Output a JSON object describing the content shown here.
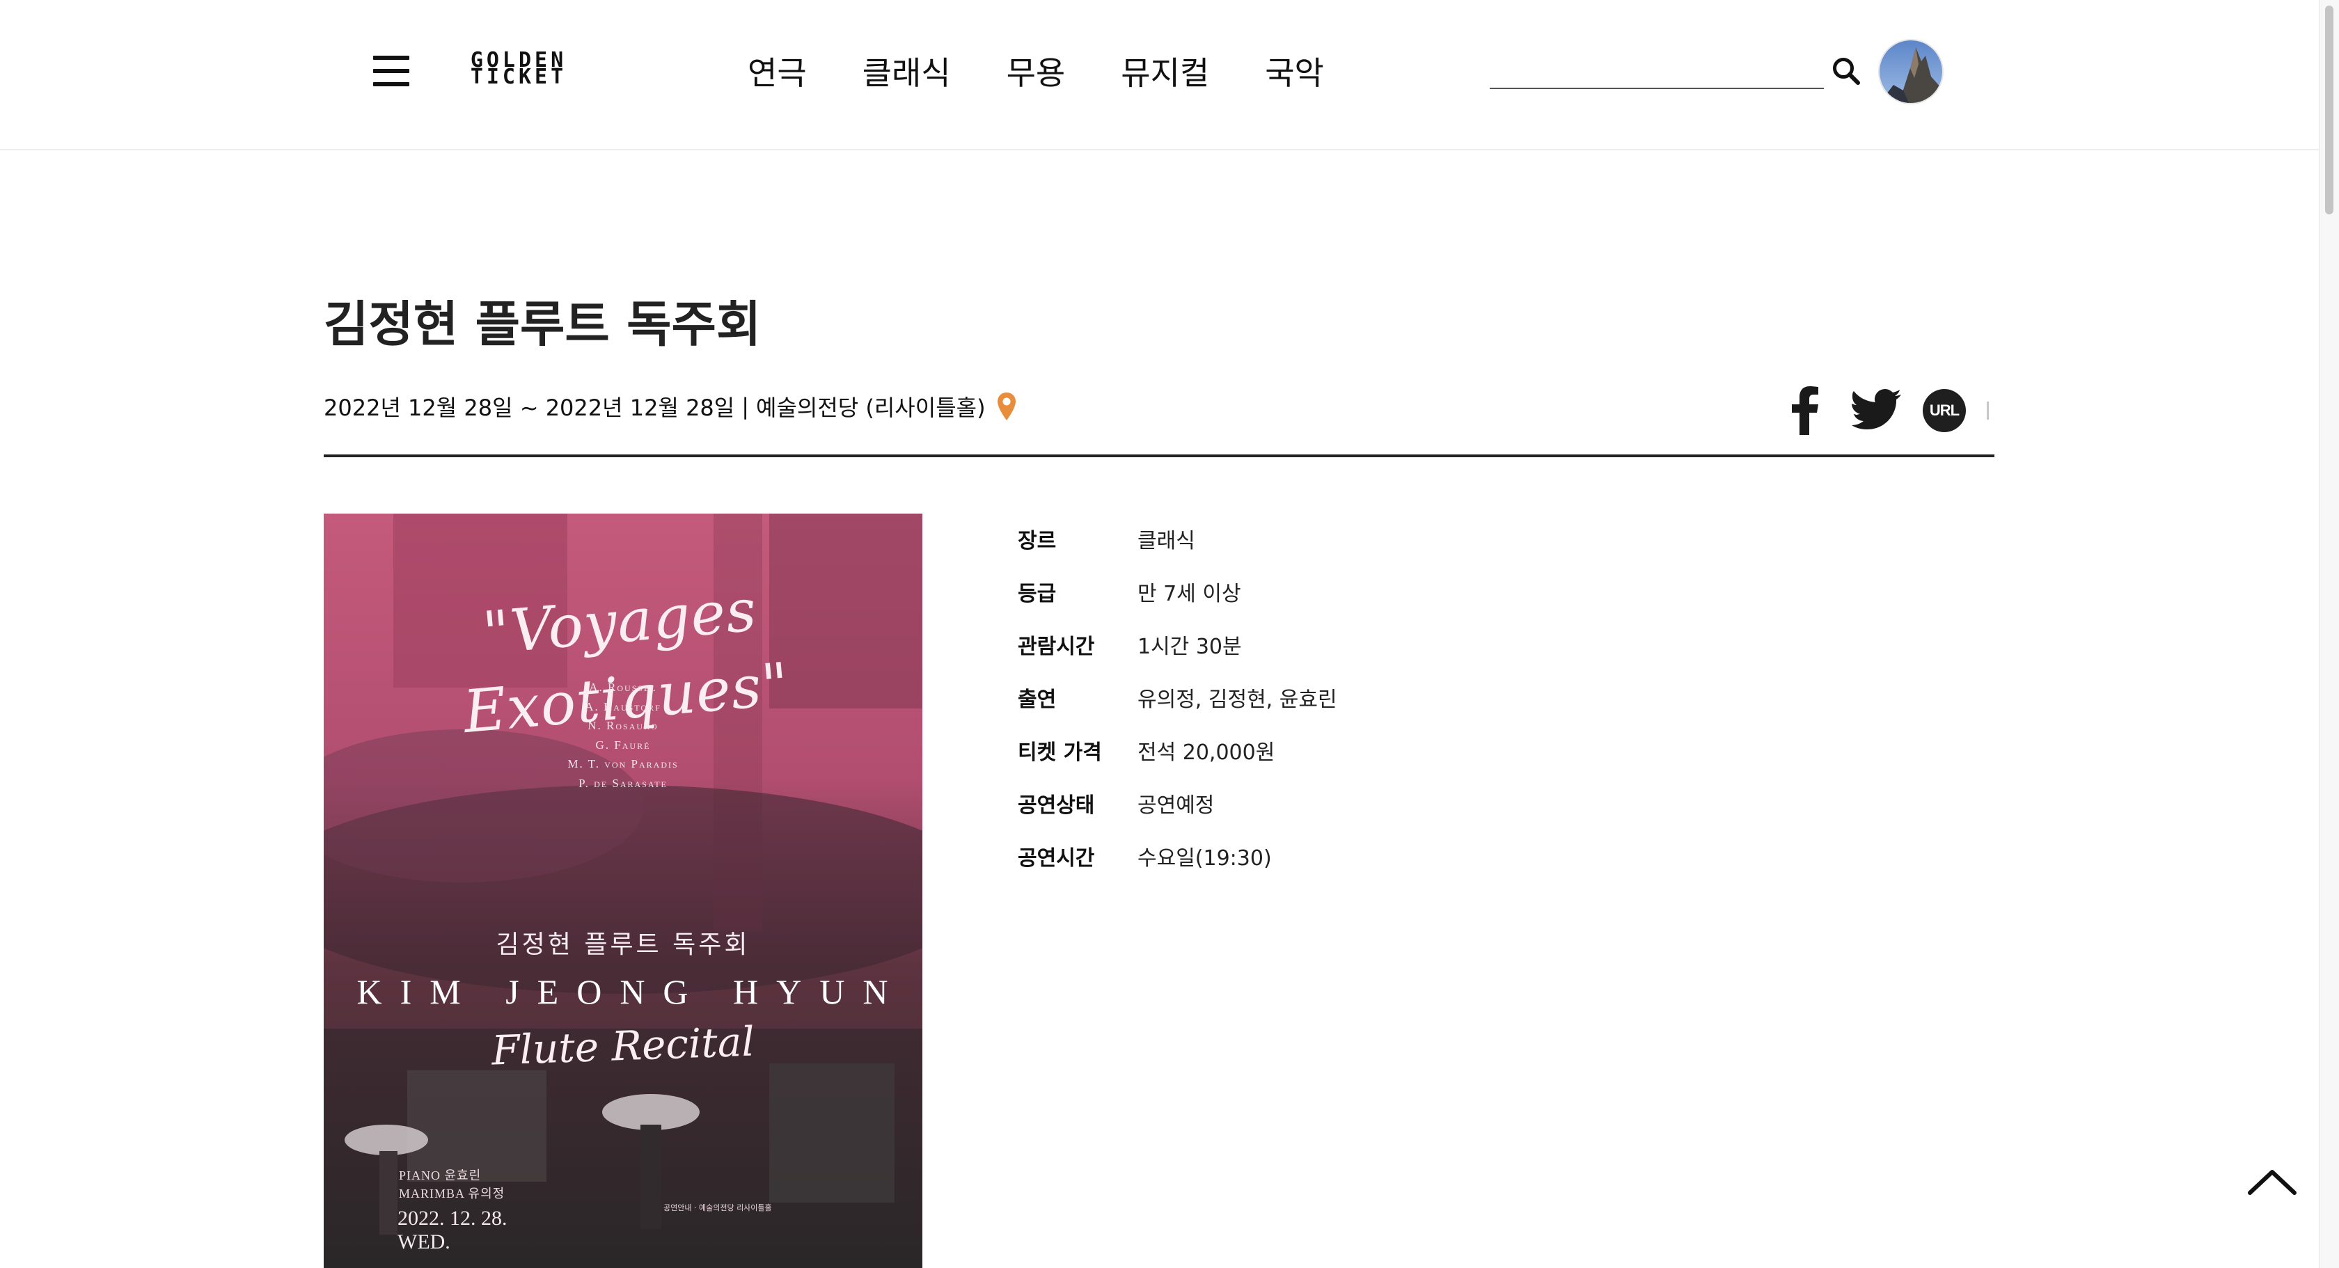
{
  "header": {
    "logo_line1": "GOLDEN",
    "logo_line2": "TICKET",
    "nav": [
      "연극",
      "클래식",
      "무용",
      "뮤지컬",
      "국악"
    ],
    "search_value": ""
  },
  "event": {
    "title": "김정현 플루트 독주회",
    "dates": "2022년 12월 28일 ~ 2022년 12월 28일",
    "separator": "|",
    "venue": "예술의전당 (리사이틀홀)"
  },
  "share": {
    "url_label": "URL"
  },
  "poster": {
    "script_title": "\"Voyages Exotiques\"",
    "composers": [
      "A. Roussel",
      "A. Haustorf",
      "N. Rosauro",
      "G. Fauré",
      "M. T. von Paradis",
      "P. de Sarasate"
    ],
    "korean_title": "김정현 플루트 독주회",
    "english_name": "KIM JEONG HYUN",
    "recital": "Flute Recital",
    "performers": [
      "PIANO 윤효린",
      "MARIMBA 유의정"
    ],
    "date": "2022. 12. 28.",
    "weekday": "WED.",
    "fine_print": "공연안내 · 예술의전당 리사이틀홀"
  },
  "info": [
    {
      "label": "장르",
      "value": "클래식"
    },
    {
      "label": "등급",
      "value": "만 7세 이상"
    },
    {
      "label": "관람시간",
      "value": "1시간 30분"
    },
    {
      "label": "출연",
      "value": "유의정, 김정현, 윤효린"
    },
    {
      "label": "티켓 가격",
      "value": "전석 20,000원"
    },
    {
      "label": "공연상태",
      "value": "공연예정"
    },
    {
      "label": "공연시간",
      "value": "수요일(19:30)"
    }
  ],
  "colors": {
    "accent_pin": "#e88d3c",
    "poster_tint": "#b8526f",
    "text": "#1a1a1a"
  },
  "icons": [
    "hamburger-menu-icon",
    "search-icon",
    "map-pin-icon",
    "facebook-icon",
    "twitter-icon",
    "url-link-icon",
    "chevron-up-icon"
  ]
}
